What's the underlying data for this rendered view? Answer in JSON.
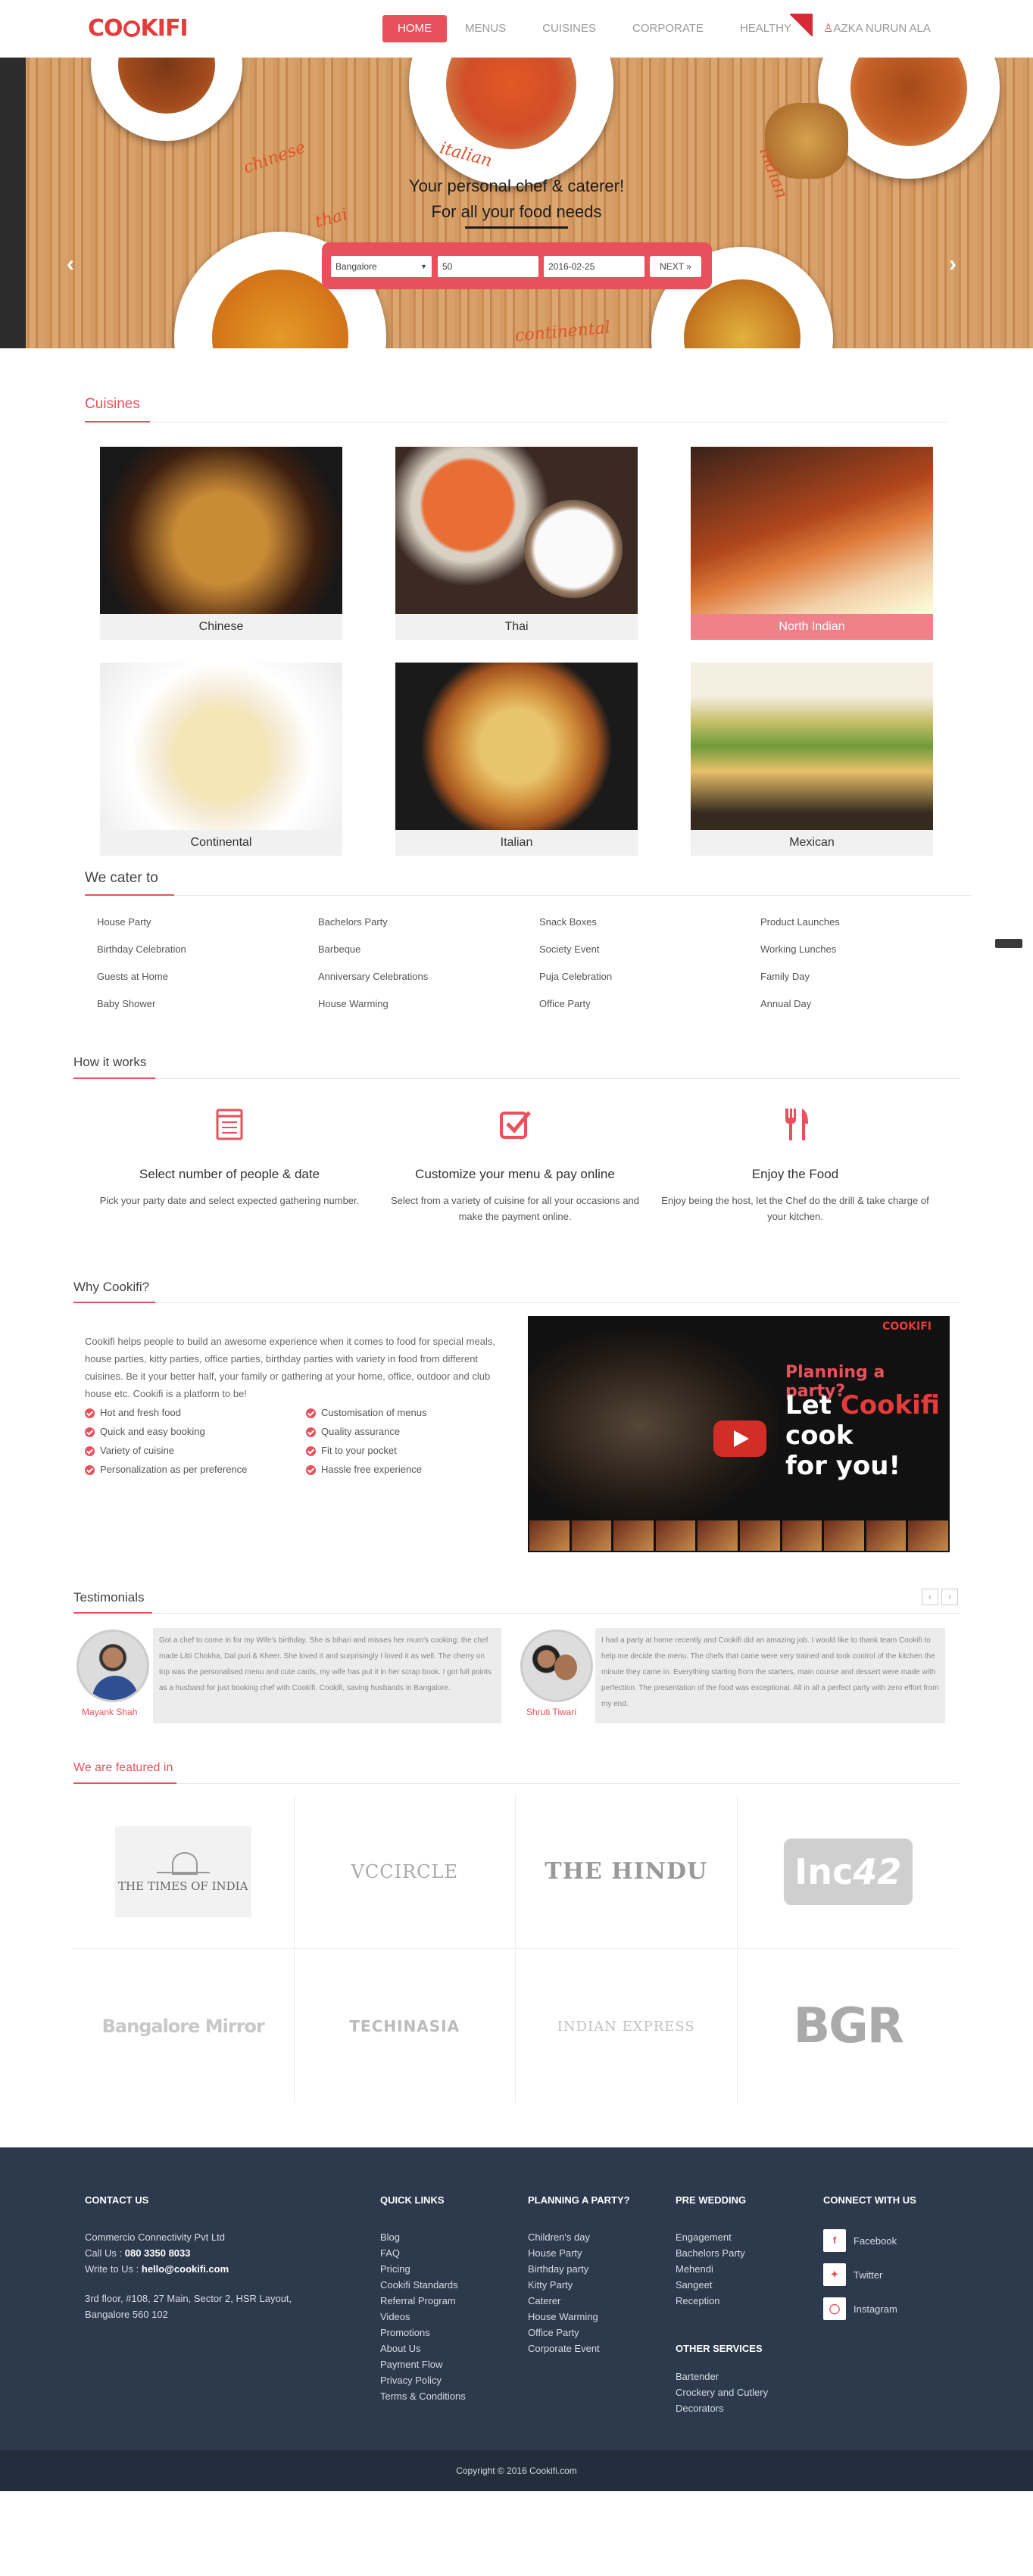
{
  "brand": {
    "logo_left": "CO",
    "logo_right": "KIFI"
  },
  "nav": {
    "home": "HOME",
    "menus": "MENUS",
    "cuisines": "CUISINES",
    "corporate": "CORPORATE",
    "healthy": "HEALTHY",
    "user": "AZKA NURUN ALA"
  },
  "hero": {
    "food_words": [
      "chinese",
      "italian",
      "thai",
      "indian",
      "continental"
    ],
    "tagline_1": "Your personal chef & caterer!",
    "tagline_2": "For all your food needs",
    "search": {
      "city": "Bangalore",
      "people": "50",
      "date": "2016-02-25",
      "next": "NEXT »"
    },
    "prev_arrow": "‹",
    "next_arrow": "›",
    "slide_count": 5,
    "active_slide": 3
  },
  "cuisines": {
    "title": "Cuisines",
    "items": [
      {
        "name": "Chinese"
      },
      {
        "name": "Thai"
      },
      {
        "name": "North Indian"
      },
      {
        "name": "Continental"
      },
      {
        "name": "Italian"
      },
      {
        "name": "Mexican"
      }
    ]
  },
  "cater": {
    "title": "We cater to",
    "items": [
      "House Party",
      "Bachelors Party",
      "Snack Boxes",
      "Product Launches",
      "Birthday Celebration",
      "Barbeque",
      "Society Event",
      "Working Lunches",
      "Guests at Home",
      "Anniversary Celebrations",
      "Puja Celebration",
      "Family Day",
      "Baby Shower",
      "House Warming",
      "Office Party",
      "Annual Day"
    ]
  },
  "how": {
    "title": "How it works",
    "steps": [
      {
        "title": "Select number of people & date",
        "desc": "Pick your party date and select expected gathering number."
      },
      {
        "title": "Customize your menu & pay online",
        "desc": "Select from a variety of cuisine for all your occasions and make the payment online."
      },
      {
        "title": "Enjoy the Food",
        "desc": "Enjoy being the host, let the Chef do the drill & take charge of your kitchen."
      }
    ]
  },
  "why": {
    "title": "Why Cookifi?",
    "text": "Cookifi helps people to build an awesome experience when it comes to food for special meals, house parties, kitty parties, office parties, birthday parties with variety in food from different cuisines. Be it your better half, your family or gathering at your home, office, outdoor and club house etc. Cookifi is a platform to be!",
    "points": [
      "Hot and fresh food",
      "Customisation of menus",
      "Quick and easy booking",
      "Quality assurance",
      "Variety of cuisine",
      "Fit to your pocket",
      "Personalization as per preference",
      "Hassle free experience"
    ],
    "video": {
      "brand": "COOKIFI",
      "line1": "Planning a party?",
      "line2a": "Let ",
      "line2b": "Cookifi",
      "line3": "cook",
      "line4": "for you!"
    }
  },
  "testimonials": {
    "title": "Testimonials",
    "prev": "‹",
    "next": "›",
    "items": [
      {
        "name": "Mayank Shah",
        "text": "Got a chef to come in for my Wife's birthday. She is bihari and misses her mum's cooking; the chef made Litti Chokha, Dal puri & Kheer. She loved it and surprisingly I loved it as well. The cherry on top was the personalised menu and cute cards, my wife has put it in her scrap book. I got full points as a husband for just booking chef with Cookifi. Cookifi, saving husbands in Bangalore."
      },
      {
        "name": "Shruti Tiwari",
        "text": "I had a party at home recently and Cookifi did an amazing job. I would like to thank team Cookifi to help me decide the menu. The chefs that came were very trained and took control of the kitchen the minute they came in. Everything starting from the starters, main course and dessert were made with perfection. The presentation of the food was exceptional. All in all a perfect party with zero effort from my end."
      }
    ]
  },
  "featured": {
    "title": "We are featured in",
    "logos": {
      "toi": "THE TIMES OF INDIA",
      "vccircle": "VCCIRCLE",
      "hindu": "THE HINDU",
      "inc42_a": "Inc",
      "inc42_b": "42",
      "blr_mirror": "Bangalore Mirror",
      "techinasia": "TECHINASIA",
      "indian_express": "INDIAN EXPRESS",
      "bgr": "BGR"
    }
  },
  "footer": {
    "contact": {
      "title": "CONTACT US",
      "company": "Commercio Connectivity Pvt Ltd",
      "call_label": "Call Us : ",
      "phone": "080 3350 8033",
      "write_label": "Write to Us : ",
      "email": "hello@cookifi.com",
      "address_1": "3rd floor, #108, 27 Main, Sector 2, HSR Layout,",
      "address_2": "Bangalore 560 102"
    },
    "quick_links": {
      "title": "QUICK LINKS",
      "items": [
        "Blog",
        "FAQ",
        "Pricing",
        "Cookifi Standards",
        "Referral Program",
        "Videos",
        "Promotions",
        "About Us",
        "Payment Flow",
        "Privacy Policy",
        "Terms & Conditions"
      ]
    },
    "planning": {
      "title": "PLANNING A PARTY?",
      "items": [
        "Children's day",
        "House Party",
        "Birthday party",
        "Kitty Party",
        "Caterer",
        "House Warming",
        "Office Party",
        "Corporate Event"
      ]
    },
    "pre_wedding": {
      "title": "PRE WEDDING",
      "items": [
        "Engagement",
        "Bachelors Party",
        "Mehendi",
        "Sangeet",
        "Reception"
      ]
    },
    "other": {
      "title": "OTHER SERVICES",
      "items": [
        "Bartender",
        "Crockery and Cutlery",
        "Decorators"
      ]
    },
    "connect": {
      "title": "CONNECT WITH US",
      "facebook": "Facebook",
      "twitter": "Twitter",
      "instagram": "Instagram"
    },
    "copyright": "Copyright © 2016 Cookifi.com"
  },
  "colors": {
    "accent": "#e8515b",
    "footer_bg": "#2d3a4d",
    "copyright_bg": "#232d3c"
  }
}
